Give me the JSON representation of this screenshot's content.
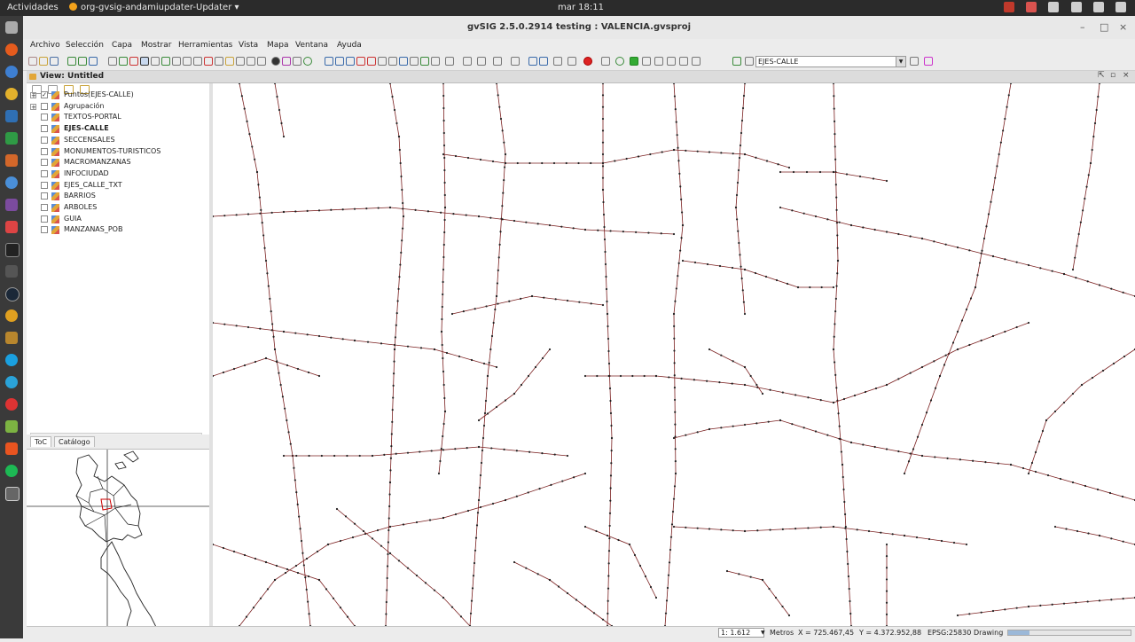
{
  "topbar": {
    "activities": "Actividades",
    "app_name": "org-gvsig-andamiupdater-Updater",
    "clock": "mar 18:11"
  },
  "window": {
    "title": "gvSIG 2.5.0.2914 testing : VALENCIA.gvsproj"
  },
  "menu": [
    "Archivo",
    "Selección",
    "Capa",
    "Mostrar",
    "Herramientas",
    "Vista",
    "Mapa",
    "Ventana",
    "Ayuda"
  ],
  "toolbar": {
    "active_layer": "EJES-CALLE"
  },
  "view": {
    "title": "View: Untitled"
  },
  "toc": {
    "layers": [
      {
        "name": "Puntos(EJES-CALLE)",
        "checked": true,
        "expand": "+"
      },
      {
        "name": "Agrupación",
        "checked": false,
        "expand": "+"
      },
      {
        "name": "TEXTOS-PORTAL",
        "checked": false
      },
      {
        "name": "EJES-CALLE",
        "checked": false,
        "bold": true
      },
      {
        "name": "SECCENSALES",
        "checked": false
      },
      {
        "name": "MONUMENTOS-TURISTICOS",
        "checked": false
      },
      {
        "name": "MACROMANZANAS",
        "checked": false
      },
      {
        "name": "INFOCIUDAD",
        "checked": false
      },
      {
        "name": "EJES_CALLE_TXT",
        "checked": false
      },
      {
        "name": "BARRIOS",
        "checked": false
      },
      {
        "name": "ARBOLES",
        "checked": false
      },
      {
        "name": "GUIA",
        "checked": false
      },
      {
        "name": "MANZANAS_POB",
        "checked": false
      }
    ],
    "tabs": [
      "ToC",
      "Catálogo"
    ]
  },
  "status": {
    "scale": "1: 1.612",
    "units": "Metros",
    "x": "X = 725.467,45",
    "y": "Y = 4.372.952,88",
    "crs": "EPSG:25830",
    "mode": "Drawing"
  },
  "colors": {
    "line": "#7a1f1f",
    "point": "#222222"
  }
}
